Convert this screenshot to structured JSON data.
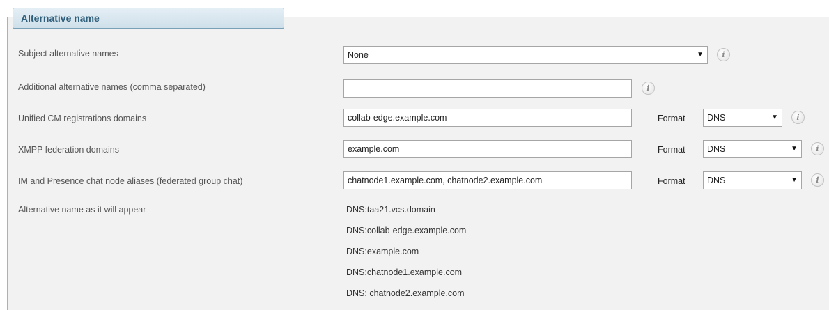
{
  "section": {
    "title": "Alternative name"
  },
  "fields": {
    "subject_alt_names": {
      "label": "Subject alternative names",
      "value": "None"
    },
    "additional_alt_names": {
      "label": "Additional alternative names (comma separated)",
      "value": ""
    },
    "ucm_domains": {
      "label": "Unified CM registrations domains",
      "value": "collab-edge.example.com",
      "format_label": "Format",
      "format_value": "DNS"
    },
    "xmpp_domains": {
      "label": "XMPP federation domains",
      "value": "example.com",
      "format_label": "Format",
      "format_value": "DNS"
    },
    "im_presence_aliases": {
      "label": "IM and Presence chat node aliases (federated group chat)",
      "value": "chatnode1.example.com, chatnode2.example.com",
      "format_label": "Format",
      "format_value": "DNS"
    },
    "alt_name_preview": {
      "label": "Alternative name as it will appear",
      "lines": [
        "DNS:taa21.vcs.domain",
        "DNS:collab-edge.example.com",
        "DNS:example.com",
        "DNS:chatnode1.example.com",
        "DNS: chatnode2.example.com"
      ]
    }
  },
  "icons": {
    "info": "i",
    "dropdown_arrow": "▼"
  }
}
